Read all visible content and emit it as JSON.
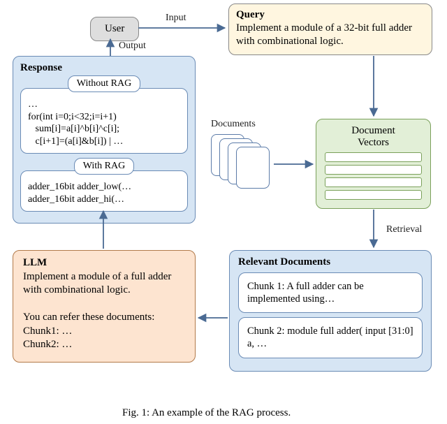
{
  "user": {
    "label": "User"
  },
  "edges": {
    "input": "Input",
    "output": "Output",
    "documents": "Documents",
    "retrieval": "Retrieval"
  },
  "query": {
    "title": "Query",
    "body": "Implement a module of a 32-bit full adder with combinational logic."
  },
  "response": {
    "title": "Response",
    "without_label": "Without RAG",
    "without_body": "…\nfor(int i=0;i<32;i=i+1)\n   sum[i]=a[i]^b[i]^c[i];\n   c[i+1]=(a[i]&b[i]) | …",
    "with_label": "With RAG",
    "with_body": "adder_16bit adder_low(…\nadder_16bit adder_hi(…"
  },
  "docvec": {
    "title": "Document\nVectors"
  },
  "llm": {
    "title": "LLM",
    "body": "Implement a module of a full adder with combinational logic.\n\nYou can refer these documents:\nChunk1: …\nChunk2: …"
  },
  "reldocs": {
    "title": "Relevant Documents",
    "chunk1": "Chunk 1: A full adder can be implemented using…",
    "chunk2": "Chunk 2: module full adder( input [31:0] a, …"
  },
  "caption": "Fig. 1: An example of the RAG process."
}
